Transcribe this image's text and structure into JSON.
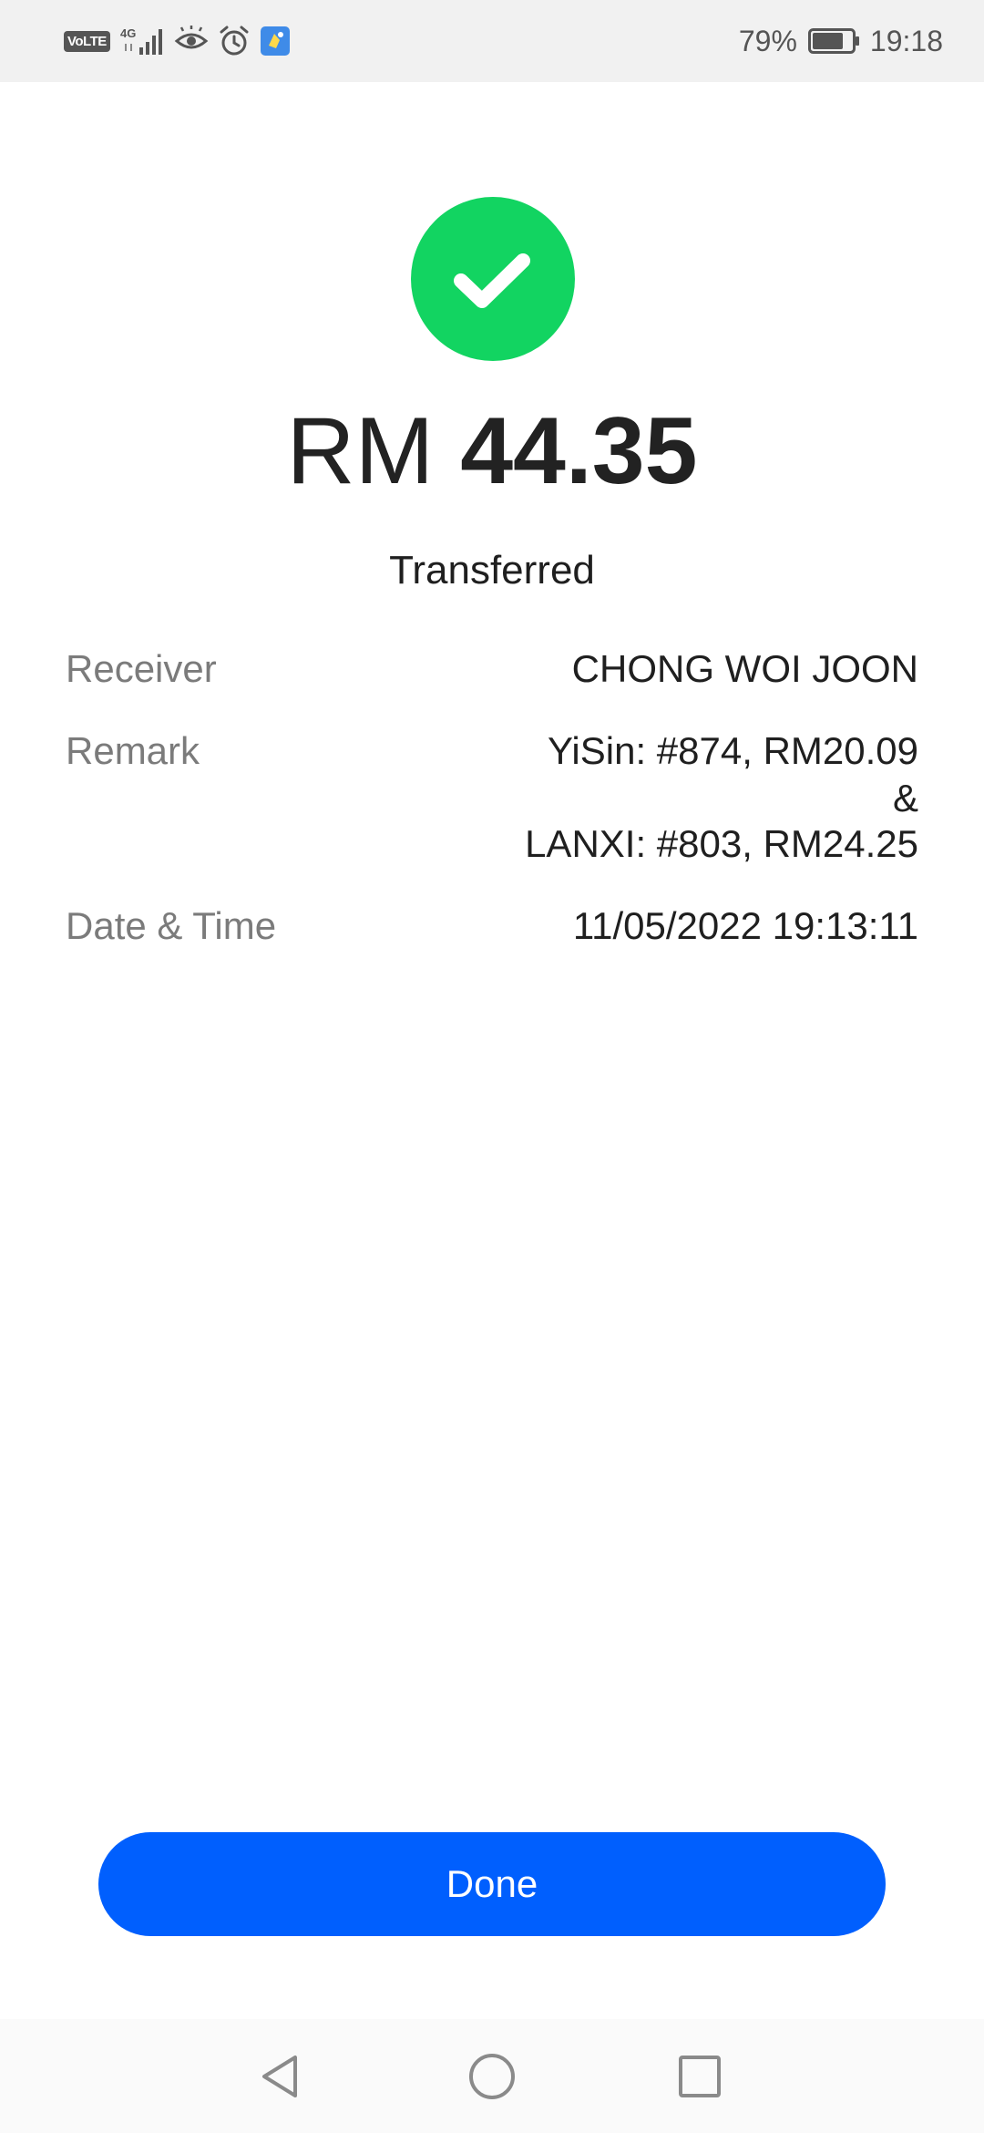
{
  "status_bar": {
    "network_badge": "VoLTE",
    "network_type": "4G",
    "icons": [
      "volte-icon",
      "signal-icon",
      "eye-icon",
      "alarm-icon",
      "app-notification-icon"
    ],
    "battery_percent": "79%",
    "battery_level": 0.79,
    "time": "19:18"
  },
  "receipt": {
    "currency": "RM",
    "amount": "44.35",
    "status": "Transferred",
    "success_color": "#12d461",
    "details": {
      "receiver_label": "Receiver",
      "receiver_value": "CHONG WOI JOON",
      "remark_label": "Remark",
      "remark_line1": "YiSin: #874, RM20.09",
      "remark_line2": "&",
      "remark_line3": "LANXI: #803, RM24.25",
      "datetime_label": "Date & Time",
      "datetime_value": "11/05/2022 19:13:11"
    }
  },
  "actions": {
    "done_label": "Done",
    "done_color": "#005ffe"
  },
  "nav_bar": {
    "buttons": [
      "back-icon",
      "home-icon",
      "recents-icon"
    ]
  }
}
